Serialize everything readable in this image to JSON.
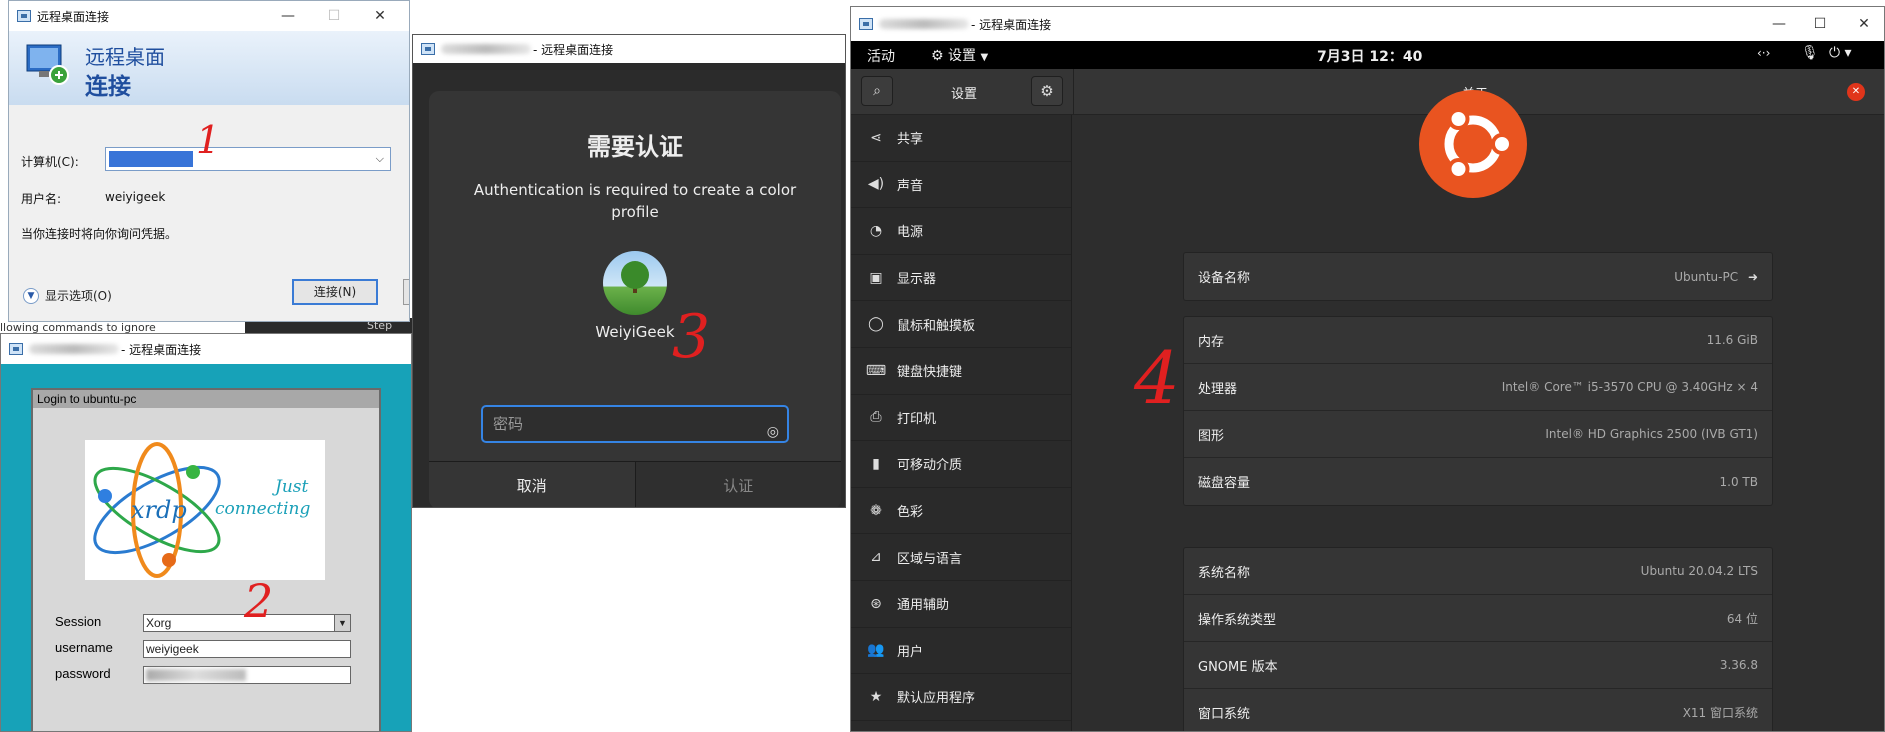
{
  "win1": {
    "title": "远程桌面连接",
    "banner_line1": "远程桌面",
    "banner_line2": "连接",
    "computer_label": "计算机(C):",
    "username_label": "用户名:",
    "username_value": "weiyigeek",
    "note": "当你连接时将向你询问凭据。",
    "connect_button": "连接(N)",
    "show_options": "显示选项(O)"
  },
  "win2": {
    "title": "- 远程桌面连接",
    "dialog_title": "Login to ubuntu-pc",
    "logo_text1": "Just",
    "logo_text2": "connecting",
    "logo_brand": "xrdp",
    "session_label": "Session",
    "session_value": "Xorg",
    "username_label": "username",
    "username_value": "weiyigeek",
    "password_label": "password"
  },
  "win3": {
    "title": "- 远程桌面连接",
    "heading": "需要认证",
    "message": "Authentication is required to create a color profile",
    "user_name": "WeiyiGeek",
    "password_placeholder": "密码",
    "cancel_button": "取消",
    "auth_button": "认证"
  },
  "win4": {
    "title": "- 远程桌面连接",
    "activities": "活动",
    "app_menu": "设置",
    "clock": "7月3日  12：40",
    "sidebar_title": "设置",
    "panel_title": "关于",
    "sidebar_items": [
      {
        "label": "共享",
        "icon": "share-icon"
      },
      {
        "label": "声音",
        "icon": "speaker-icon"
      },
      {
        "label": "电源",
        "icon": "power-icon"
      },
      {
        "label": "显示器",
        "icon": "display-icon"
      },
      {
        "label": "鼠标和触摸板",
        "icon": "mouse-icon"
      },
      {
        "label": "键盘快捷键",
        "icon": "keyboard-icon"
      },
      {
        "label": "打印机",
        "icon": "printer-icon"
      },
      {
        "label": "可移动介质",
        "icon": "usb-icon"
      },
      {
        "label": "色彩",
        "icon": "color-icon"
      },
      {
        "label": "区域与语言",
        "icon": "region-icon"
      },
      {
        "label": "通用辅助",
        "icon": "accessibility-icon"
      },
      {
        "label": "用户",
        "icon": "users-icon"
      },
      {
        "label": "默认应用程序",
        "icon": "star-icon"
      }
    ],
    "device_name_label": "设备名称",
    "device_name_value": "Ubuntu-PC",
    "hardware": [
      {
        "label": "内存",
        "value": "11.6 GiB"
      },
      {
        "label": "处理器",
        "value": "Intel® Core™ i5-3570 CPU @ 3.40GHz × 4"
      },
      {
        "label": "图形",
        "value": "Intel® HD Graphics 2500 (IVB GT1)"
      },
      {
        "label": "磁盘容量",
        "value": "1.0 TB"
      }
    ],
    "software": [
      {
        "label": "系统名称",
        "value": "Ubuntu 20.04.2 LTS"
      },
      {
        "label": "操作系统类型",
        "value": "64 位"
      },
      {
        "label": "GNOME 版本",
        "value": "3.36.8"
      },
      {
        "label": "窗口系统",
        "value": "X11 窗口系统"
      }
    ]
  },
  "annotations": {
    "n1": "1",
    "n2": "2",
    "n3": "3",
    "n4": "4"
  },
  "bg_terminal_text": "llowing commands to ignore",
  "bg_step_text": "Step"
}
